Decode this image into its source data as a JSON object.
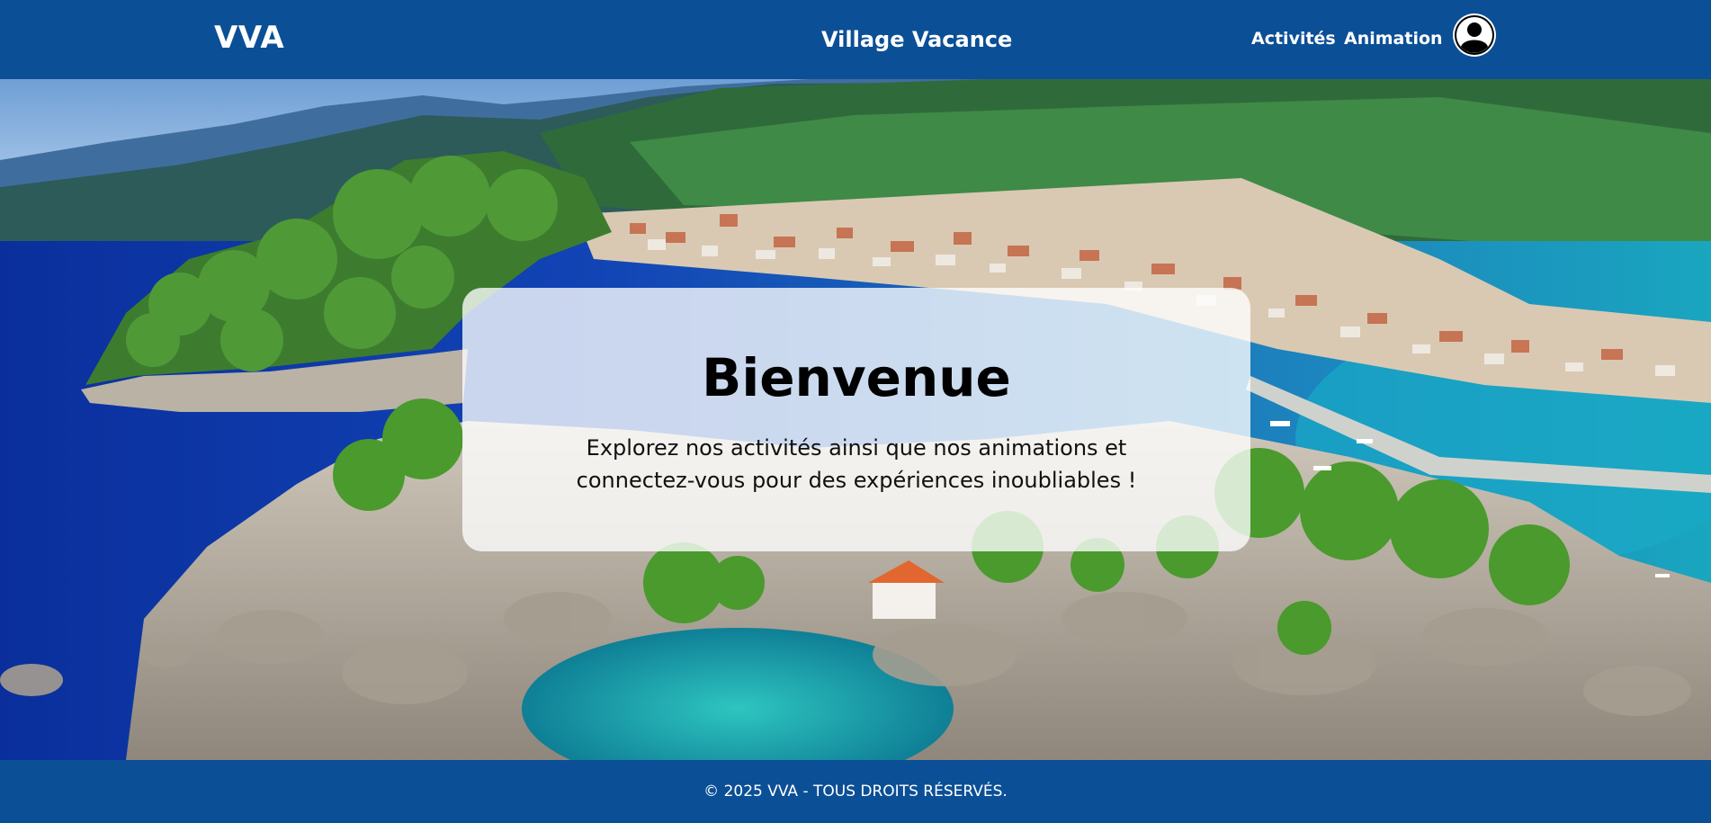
{
  "header": {
    "logo": "VVA",
    "title": "Village Vacance",
    "nav": {
      "activites": "Activités",
      "animation": "Animation"
    },
    "profile_icon": "user-avatar-icon"
  },
  "hero": {
    "background_image": "aerial-coastal-village-photo",
    "card": {
      "title": "Bienvenue",
      "text": "Explorez nos activités ainsi que nos animations et connectez-vous pour des expériences inoubliables !"
    }
  },
  "footer": {
    "copyright": "© 2025 VVA - TOUS DROITS RÉSERVÉS."
  },
  "colors": {
    "brand_blue": "#0b4f96",
    "card_bg": "rgba(255,255,255,0.78)"
  }
}
